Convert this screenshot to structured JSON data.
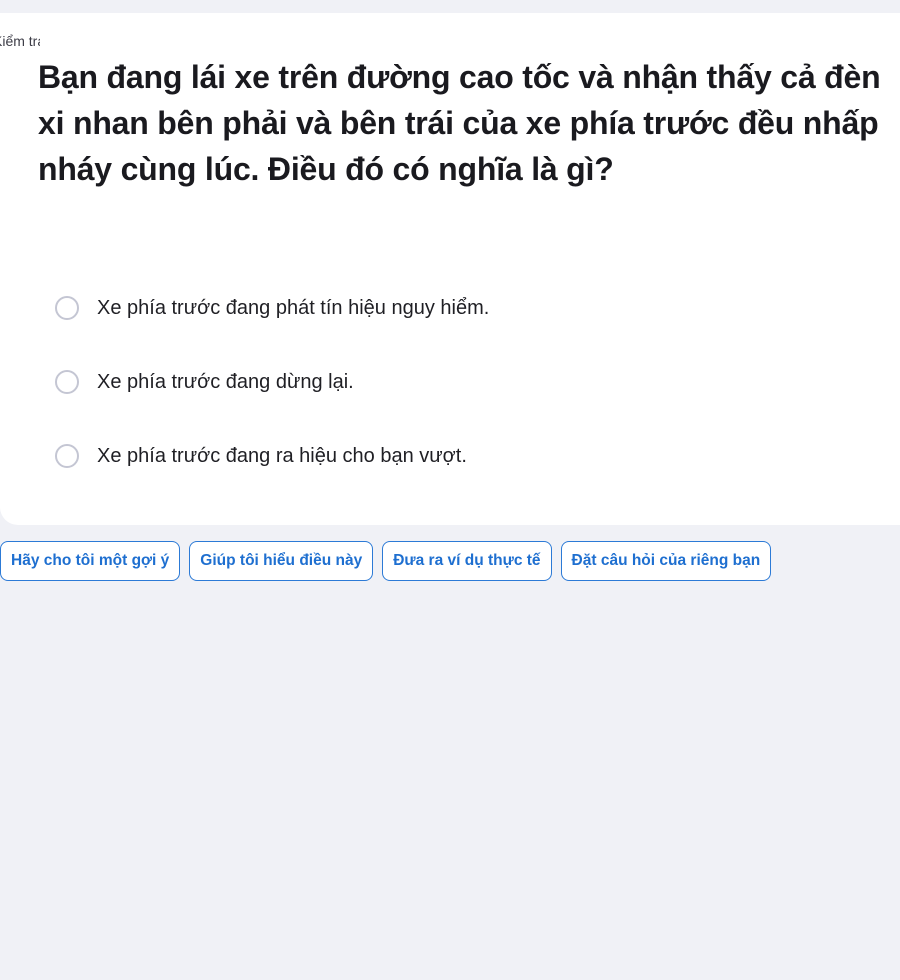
{
  "card": {
    "label": "Kiểm tra",
    "question": "Bạn đang lái xe trên đường cao tốc và nhận thấy cả đèn xi nhan bên phải và bên trái của xe phía trước đều nhấp nháy cùng lúc. Điều đó có nghĩa là gì?",
    "options": [
      {
        "label": "Xe phía trước đang phát tín hiệu nguy hiểm.",
        "selected": false
      },
      {
        "label": "Xe phía trước đang dừng lại.",
        "selected": false
      },
      {
        "label": "Xe phía trước đang ra hiệu cho bạn vượt.",
        "selected": false
      }
    ]
  },
  "suggestions": [
    {
      "label": "Hãy cho tôi một gợi ý"
    },
    {
      "label": "Giúp tôi hiểu điều này"
    },
    {
      "label": "Đưa ra ví dụ thực tế"
    },
    {
      "label": "Đặt câu hỏi của riêng bạn"
    }
  ],
  "colors": {
    "background": "#f0f1f6",
    "card": "#ffffff",
    "accent": "#1e6fd0",
    "radio_border": "#c4c6d3"
  }
}
